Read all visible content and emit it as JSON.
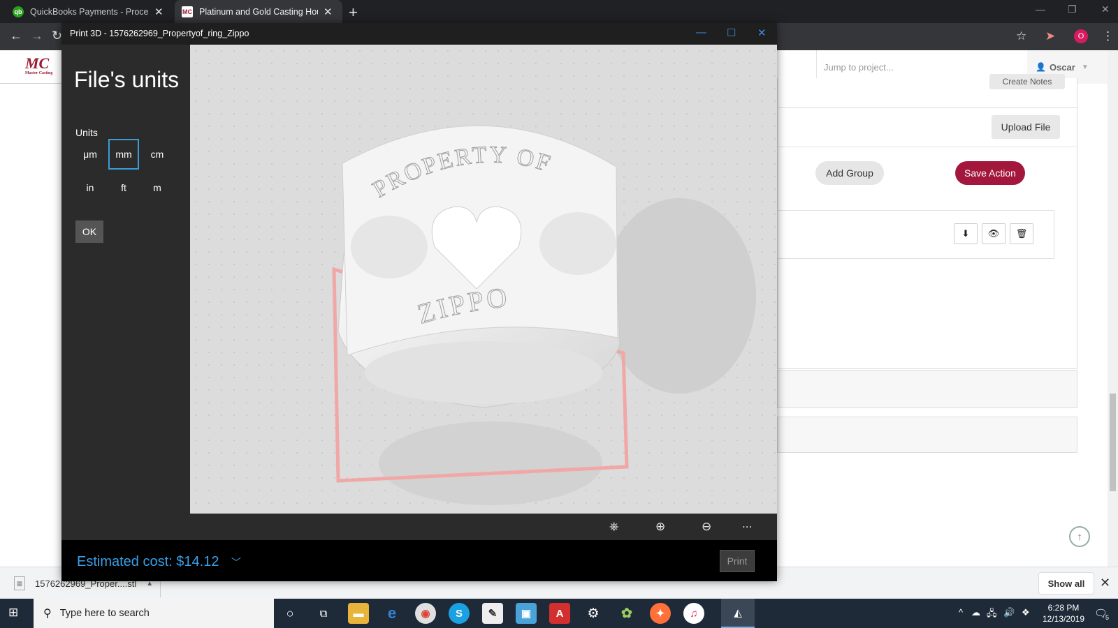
{
  "browser": {
    "tabs": [
      {
        "title": "QuickBooks Payments - Process T",
        "favicon": "qb"
      },
      {
        "title": "Platinum and Gold Casting Hous",
        "favicon": "MC"
      }
    ],
    "new_tab": "+",
    "profile_initial": "O"
  },
  "webpage": {
    "logo_text": "MC",
    "logo_sub": "Master Casting",
    "search_placeholder": "Jump to project...",
    "user_name": "Oscar",
    "create_notes_label": "Create Notes",
    "upload_file_label": "Upload File",
    "add_group_label": "Add Group",
    "save_action_label": "Save Action",
    "accent_color": "#a3173c"
  },
  "print3d": {
    "window_title": "Print 3D - 1576262969_Propertyof_ring_Zippo",
    "heading": "File's units",
    "units_label": "Units",
    "units": [
      "μm",
      "mm",
      "cm",
      "in",
      "ft",
      "m"
    ],
    "selected_unit": "mm",
    "ok_label": "OK",
    "model_text_top": "PROPERTY OF",
    "model_text_bottom": "ZIPPO",
    "estimated_cost": "Estimated cost: $14.12",
    "print_label": "Print",
    "more_label": "..."
  },
  "downloads": {
    "file_name": "1576262969_Proper....stl",
    "show_all_label": "Show all"
  },
  "taskbar": {
    "search_placeholder": "Type here to search",
    "time": "6:28 PM",
    "date": "12/13/2019",
    "notification_count": "5"
  }
}
